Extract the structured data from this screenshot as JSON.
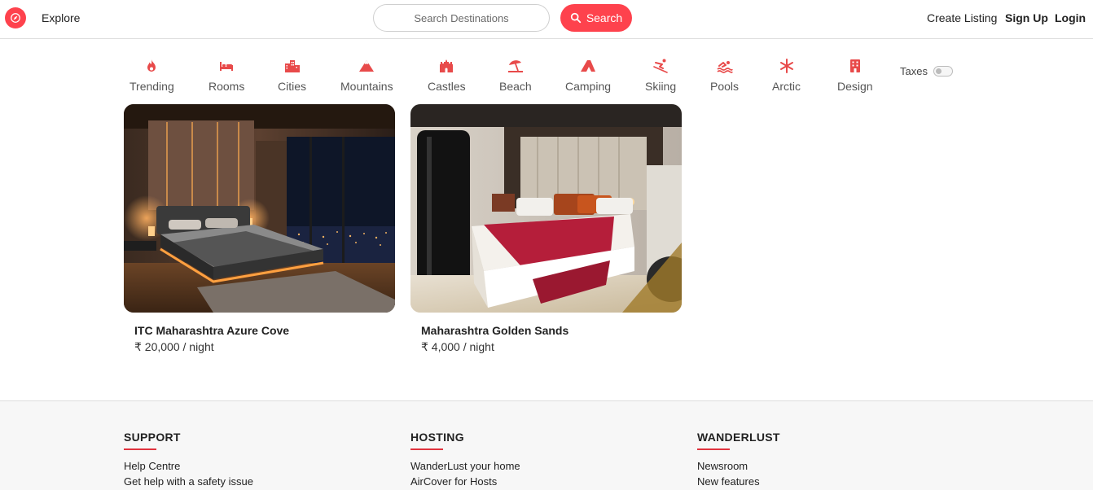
{
  "navbar": {
    "logo_icon": "compass-icon",
    "explore": "Explore",
    "search_placeholder": "Search Destinations",
    "search_button": "Search",
    "create_listing": "Create Listing",
    "sign_up": "Sign Up",
    "login": "Login",
    "accent_color": "#fe424d"
  },
  "filters": {
    "items": [
      {
        "label": "Trending",
        "icon": "fire-icon"
      },
      {
        "label": "Rooms",
        "icon": "bed-icon"
      },
      {
        "label": "Cities",
        "icon": "city-icon"
      },
      {
        "label": "Mountains",
        "icon": "mountain-icon"
      },
      {
        "label": "Castles",
        "icon": "castle-icon"
      },
      {
        "label": "Beach",
        "icon": "umbrella-beach-icon"
      },
      {
        "label": "Camping",
        "icon": "campground-icon"
      },
      {
        "label": "Skiing",
        "icon": "skiing-icon"
      },
      {
        "label": "Pools",
        "icon": "swimmer-icon"
      },
      {
        "label": "Arctic",
        "icon": "snowflake-icon"
      },
      {
        "label": "Design",
        "icon": "building-icon"
      }
    ],
    "taxes_label": "Taxes",
    "taxes_on": false
  },
  "listings": [
    {
      "title": "ITC Maharashtra Azure Cove",
      "price": "₹ 20,000 / night"
    },
    {
      "title": "Maharashtra Golden Sands",
      "price": "₹ 4,000 / night"
    }
  ],
  "footer": {
    "columns": [
      {
        "heading": "SUPPORT",
        "links": [
          "Help Centre",
          "Get help with a safety issue"
        ]
      },
      {
        "heading": "HOSTING",
        "links": [
          "WanderLust your home",
          "AirCover for Hosts"
        ]
      },
      {
        "heading": "WANDERLUST",
        "links": [
          "Newsroom",
          "New features"
        ]
      }
    ]
  }
}
